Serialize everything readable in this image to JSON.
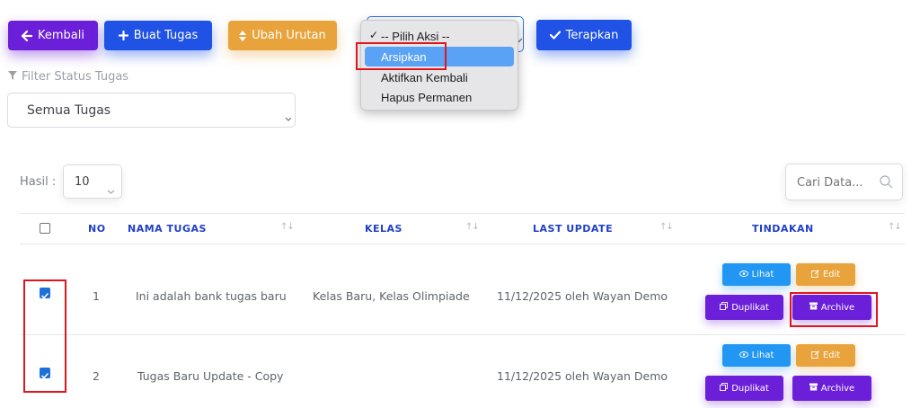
{
  "toolbar": {
    "back_label": "Kembali",
    "create_label": "Buat Tugas",
    "reorder_label": "Ubah Urutan",
    "apply_label": "Terapkan"
  },
  "action_dropdown": {
    "options": [
      "-- Pilih Aksi --",
      "Arsipkan",
      "Aktifkan Kembali",
      "Hapus Permanen"
    ],
    "checked_option": "-- Pilih Aksi --",
    "highlighted_option": "Arsipkan"
  },
  "filter": {
    "label": "Filter Status Tugas",
    "selected": "Semua Tugas"
  },
  "results": {
    "label": "Hasil :",
    "page_size": "10"
  },
  "search": {
    "placeholder": "Cari Data..."
  },
  "table": {
    "headers": {
      "no": "NO",
      "name": "NAMA TUGAS",
      "class": "KELAS",
      "updated": "LAST UPDATE",
      "actions": "TINDAKAN"
    },
    "sort_glyph": "↑↓",
    "rows": [
      {
        "no": "1",
        "name": "Ini adalah bank tugas baru",
        "class": "Kelas Baru, Kelas Olimpiade",
        "updated": "11/12/2025 oleh Wayan Demo",
        "checked": true
      },
      {
        "no": "2",
        "name": "Tugas Baru Update - Copy",
        "class": "",
        "updated": "11/12/2025 oleh Wayan Demo",
        "checked": true
      }
    ],
    "row_actions": {
      "view_label": "Lihat",
      "edit_label": "Edit",
      "duplicate_label": "Duplikat",
      "archive_label": "Archive"
    }
  },
  "colors": {
    "purple": "#6c1fd8",
    "blue": "#1f52e5",
    "orange": "#e8a33c",
    "sky": "#2196f3",
    "header_text": "#2140c6",
    "highlight": "#e0161d"
  }
}
